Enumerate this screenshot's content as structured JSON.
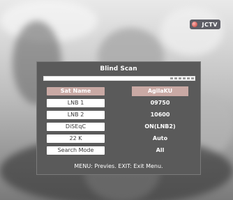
{
  "channel_logo": {
    "text": "JCTV",
    "mark_color": "#c0392b"
  },
  "dialog": {
    "title": "Blind Scan",
    "progress": 0.05,
    "rows": [
      {
        "label": "Sat Name",
        "value": "AgilaKU",
        "selected": true
      },
      {
        "label": "LNB 1",
        "value": "09750",
        "selected": false
      },
      {
        "label": "LNB 2",
        "value": "10600",
        "selected": false
      },
      {
        "label": "DiSEqC",
        "value": "ON(LNB2)",
        "selected": false
      },
      {
        "label": "22 K",
        "value": "Auto",
        "selected": false
      },
      {
        "label": "Search Mode",
        "value": "All",
        "selected": false
      }
    ],
    "footer": "MENU: Previes.  EXIT: Exit Menu."
  },
  "colors": {
    "dialog_bg": "#5a5a5a",
    "selected_bg": "#c9a9a4",
    "label_bg": "#ffffff"
  }
}
